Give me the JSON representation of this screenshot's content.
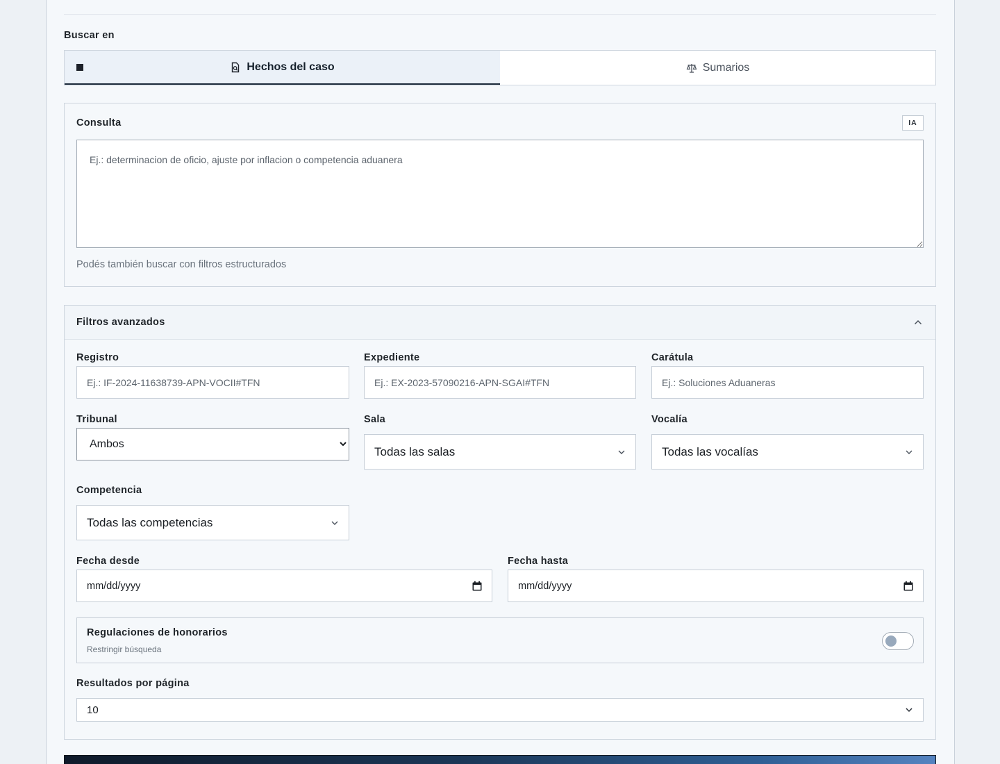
{
  "search_in": {
    "label": "Buscar en",
    "tabs": [
      {
        "label": "Hechos del caso",
        "icon": "document-search-icon",
        "active": true
      },
      {
        "label": "Sumarios",
        "icon": "scales-icon",
        "active": false
      }
    ]
  },
  "query": {
    "label": "Consulta",
    "badge": "IA",
    "placeholder": "Ej.: determinacion de oficio, ajuste por inflacion o competencia aduanera",
    "hint": "Podés también buscar con filtros estructurados"
  },
  "filters": {
    "title": "Filtros avanzados",
    "registro": {
      "label": "Registro",
      "placeholder": "Ej.: IF-2024-11638739-APN-VOCII#TFN"
    },
    "expediente": {
      "label": "Expediente",
      "placeholder": "Ej.: EX-2023-57090216-APN-SGAI#TFN"
    },
    "caratula": {
      "label": "Carátula",
      "placeholder": "Ej.: Soluciones Aduaneras"
    },
    "tribunal": {
      "label": "Tribunal",
      "value": "Ambos"
    },
    "sala": {
      "label": "Sala",
      "value": "Todas las salas"
    },
    "vocalia": {
      "label": "Vocalía",
      "value": "Todas las vocalías"
    },
    "competencia": {
      "label": "Competencia",
      "value": "Todas las competencias"
    },
    "fecha_desde": {
      "label": "Fecha desde",
      "value": "mm/dd/yyyy"
    },
    "fecha_hasta": {
      "label": "Fecha hasta",
      "value": "mm/dd/yyyy"
    },
    "honorarios": {
      "title": "Regulaciones de honorarios",
      "subtitle": "Restringir búsqueda",
      "enabled": false
    },
    "resultados": {
      "label": "Resultados por página",
      "value": "10"
    }
  }
}
